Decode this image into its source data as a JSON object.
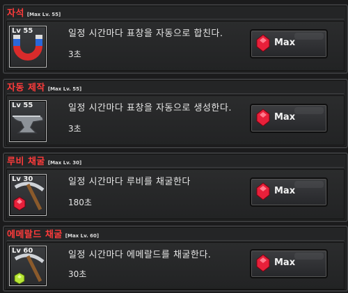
{
  "skills": [
    {
      "title": "자석",
      "max_lv": "[Max Lv. 55]",
      "level": "Lv 55",
      "icon": "magnet-icon",
      "description": "일정 시간마다 표창을 자동으로 합친다.",
      "time": "3초",
      "button_label": "Max"
    },
    {
      "title": "자동 제작",
      "max_lv": "[Max Lv. 55]",
      "level": "Lv 55",
      "icon": "anvil-icon",
      "description": "일정 시간마다 표창을 자동으로 생성한다.",
      "time": "3초",
      "button_label": "Max"
    },
    {
      "title": "루비 채굴",
      "max_lv": "[Max Lv. 30]",
      "level": "Lv 30",
      "icon": "pickaxe-ruby-icon",
      "description": "일정 시간마다 루비를 채굴한다",
      "time": "180초",
      "button_label": "Max"
    },
    {
      "title": "에메랄드 채굴",
      "max_lv": "[Max Lv. 60]",
      "level": "Lv 60",
      "icon": "pickaxe-emerald-icon",
      "description": "일정 시간마다 에메랄드를 채굴한다.",
      "time": "30초",
      "button_label": "Max"
    }
  ],
  "colors": {
    "title": "#ff3b3b",
    "ruby": "#e8203a",
    "emerald": "#b8e636"
  }
}
